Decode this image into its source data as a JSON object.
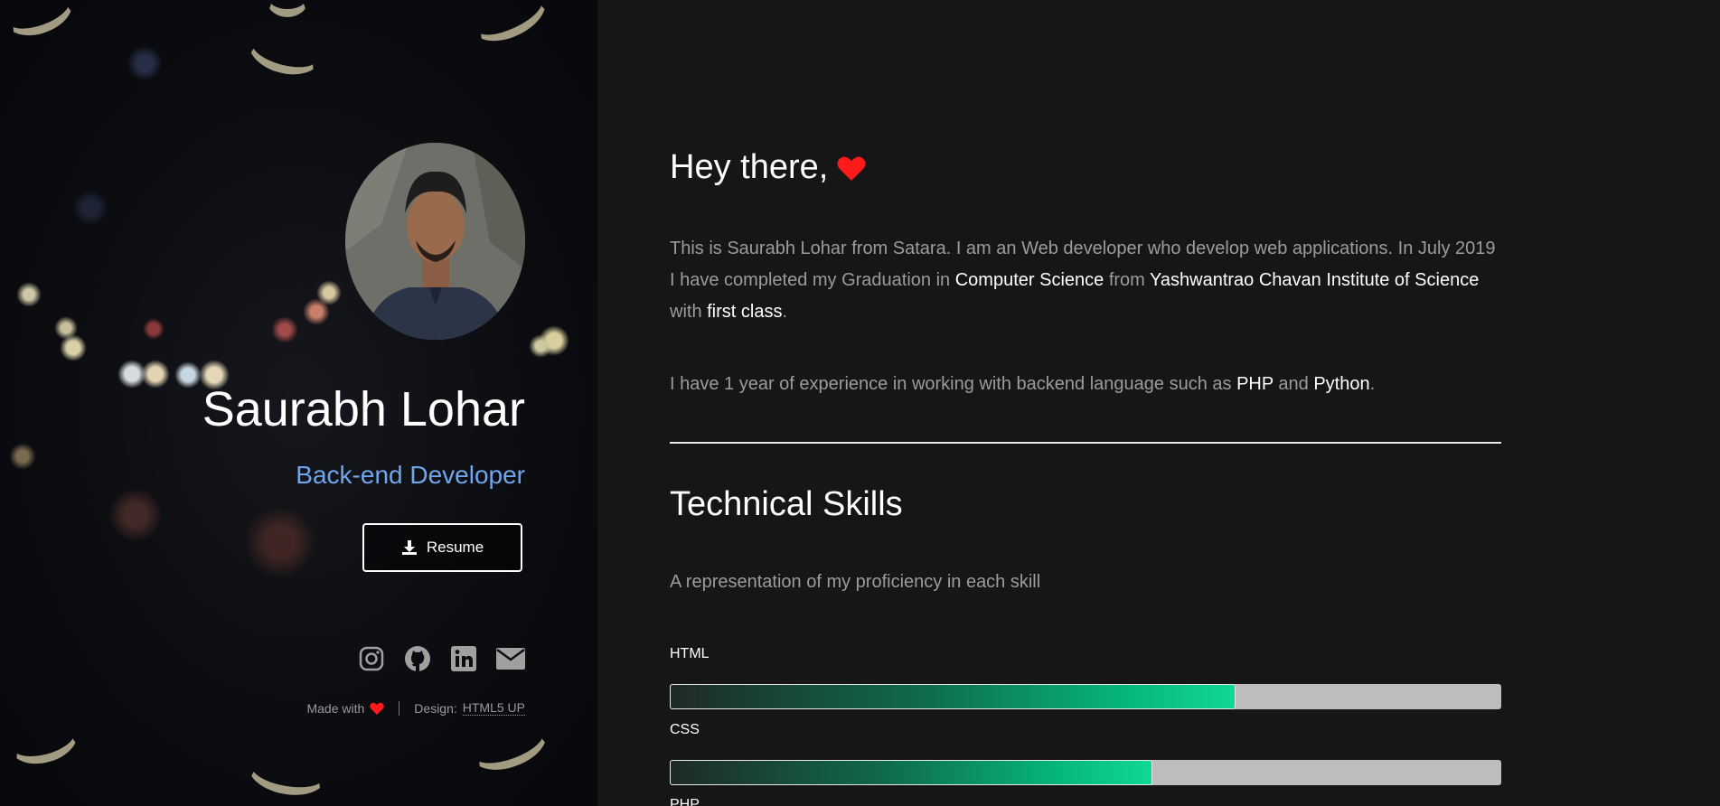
{
  "sidebar": {
    "name": "Saurabh Lohar",
    "role": "Back-end Developer",
    "resume_label": "Resume",
    "social_icons": [
      "instagram-icon",
      "github-icon",
      "linkedin-icon",
      "envelope-icon"
    ],
    "credits": {
      "made_with": "Made with",
      "design_label": "Design:",
      "design_link": "HTML5 UP"
    }
  },
  "main": {
    "greeting": "Hey there,",
    "intro": {
      "part1": "This is Saurabh Lohar from Satara. I am an Web developer who develop web applications. In July 2019 I have completed my Graduation in ",
      "degree": "Computer Science",
      "part2": " from ",
      "institute": "Yashwantrao Chavan Institute of Science",
      "part3": " with ",
      "grade": "first class",
      "part4": "."
    },
    "experience": {
      "part1": "I have 1 year of experience in working with backend language such as ",
      "lang1": "PHP",
      "part2": " and ",
      "lang2": "Python",
      "part3": "."
    },
    "skills_title": "Technical Skills",
    "skills_subtitle": "A representation of my proficiency in each skill",
    "skills": [
      {
        "label": "HTML",
        "percent": 68
      },
      {
        "label": "CSS",
        "percent": 58
      },
      {
        "label": "PHP",
        "percent": 0
      }
    ]
  },
  "colors": {
    "accent_blue": "#6fa6ee",
    "heart_red": "#ff1a1a",
    "bar_green": "#0fd896",
    "background": "#161616"
  }
}
